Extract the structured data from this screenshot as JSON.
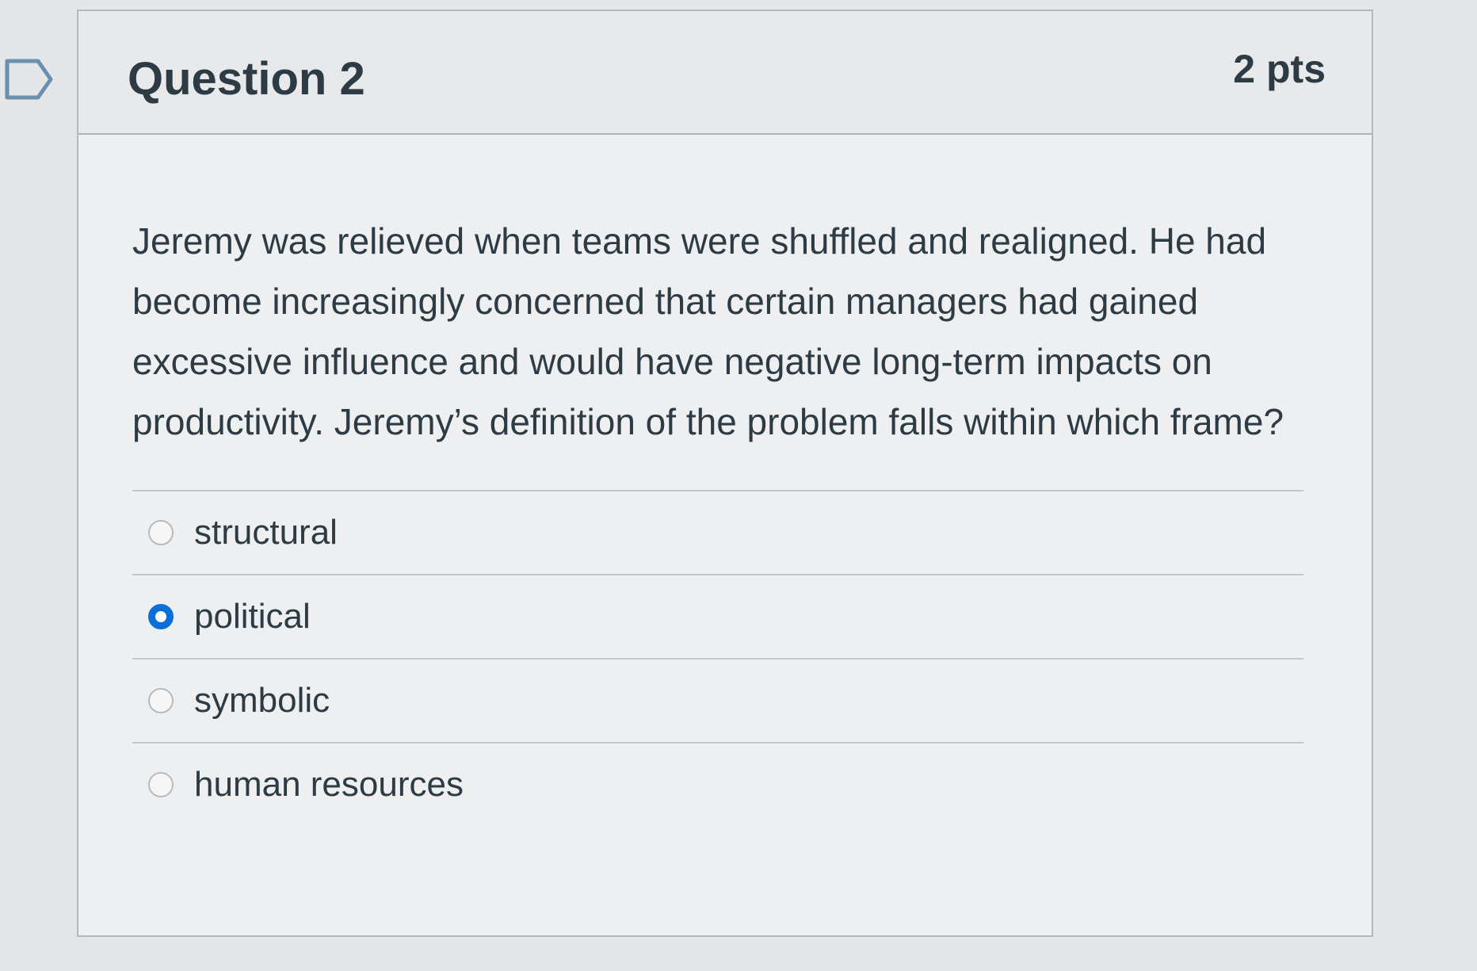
{
  "question": {
    "title": "Question 2",
    "points": "2 pts",
    "flag_icon": "bookmark-flag-icon",
    "text": "Jeremy was relieved when teams were shuffled and realigned. He had become increasingly concerned that certain managers had gained excessive influence and would have negative long-term impacts on productivity. Jeremy’s definition of the problem falls within which frame?",
    "answers": [
      {
        "label": "structural",
        "selected": false
      },
      {
        "label": "political",
        "selected": true
      },
      {
        "label": "symbolic",
        "selected": false
      },
      {
        "label": "human resources",
        "selected": false
      }
    ]
  },
  "colors": {
    "accent": "#0a6fd6",
    "text": "#2d3b45",
    "flag": "#6a8fb0"
  }
}
